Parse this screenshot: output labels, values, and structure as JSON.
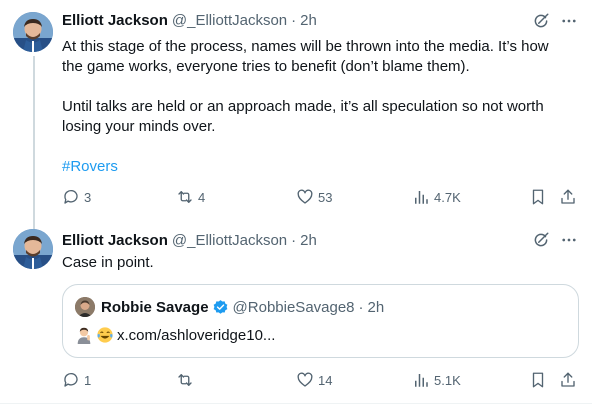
{
  "tweets": [
    {
      "author": {
        "name": "Elliott Jackson",
        "handle": "@_ElliottJackson",
        "time": "2h"
      },
      "body": {
        "p1": "At this stage of the process, names will be thrown into the media. It’s how the game works, everyone tries to benefit (don’t blame them).",
        "p2": "Until talks are held or an approach made, it’s all speculation so not worth losing your minds over.",
        "hashtag": "#Rovers"
      },
      "stats": {
        "replies": "3",
        "reposts": "4",
        "likes": "53",
        "views": "4.7K"
      }
    },
    {
      "author": {
        "name": "Elliott Jackson",
        "handle": "@_ElliottJackson",
        "time": "2h"
      },
      "body": {
        "p1": "Case in point."
      },
      "quote": {
        "author": {
          "name": "Robbie Savage",
          "handle": "@RobbieSavage8",
          "time": "2h",
          "verified": true
        },
        "emojis": [
          "man-gesturing-icon",
          "face-with-tears-of-joy-icon"
        ],
        "link": "x.com/ashloveridge10..."
      },
      "stats": {
        "replies": "1",
        "reposts": "",
        "likes": "14",
        "views": "5.1K"
      }
    }
  ],
  "ui": {
    "dot_separator": "·"
  },
  "colors": {
    "accent": "#1d9bf0",
    "muted": "#536471",
    "text": "#0f1419",
    "border": "#cfd9de",
    "verified": "#1d9bf0"
  },
  "icons": [
    "grok-icon",
    "more-icon",
    "reply-icon",
    "repost-icon",
    "like-icon",
    "views-icon",
    "bookmark-icon",
    "share-icon"
  ]
}
